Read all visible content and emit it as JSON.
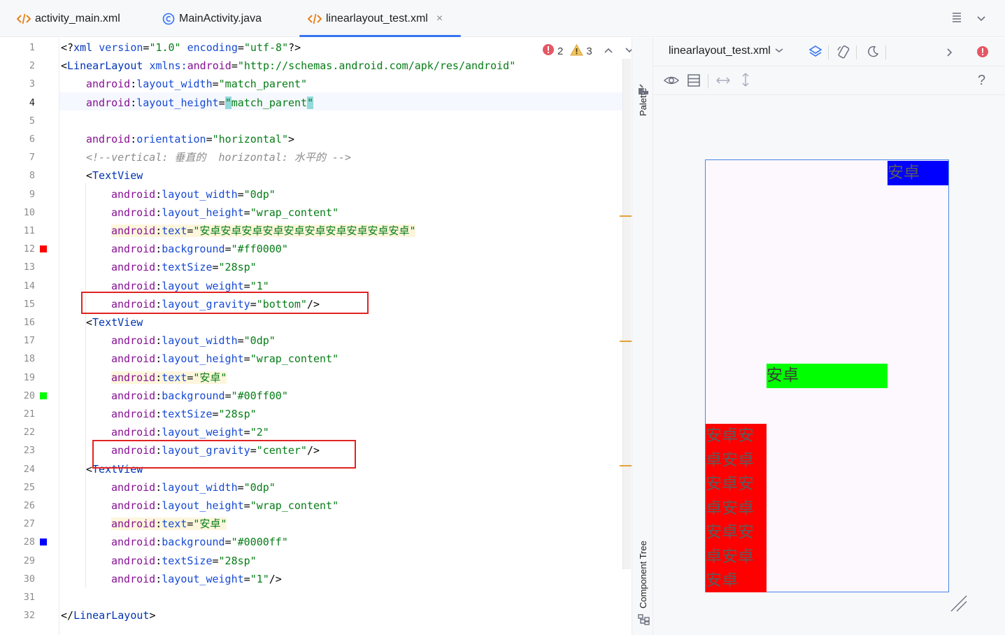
{
  "tabs": [
    {
      "label": "activity_main.xml",
      "icon": "xml-file-icon",
      "active": false
    },
    {
      "label": "MainActivity.java",
      "icon": "java-class-icon",
      "active": false
    },
    {
      "label": "linearlayout_test.xml",
      "icon": "xml-file-icon",
      "active": true,
      "close": "×"
    }
  ],
  "editor": {
    "inspection": {
      "errors": "2",
      "warnings": "3"
    },
    "current_line": 4,
    "lines": [
      {
        "n": "1",
        "tokens": [
          [
            "pl",
            "<?"
          ],
          [
            "tg",
            "xml "
          ],
          [
            "an",
            "version"
          ],
          [
            "pl",
            "="
          ],
          [
            "vl",
            "\"1.0\""
          ],
          [
            "pl",
            " "
          ],
          [
            "an",
            "encoding"
          ],
          [
            "pl",
            "="
          ],
          [
            "vl",
            "\"utf-8\""
          ],
          [
            "pl",
            "?>"
          ]
        ]
      },
      {
        "n": "2",
        "tokens": [
          [
            "pl",
            "<"
          ],
          [
            "tg",
            "LinearLayout "
          ],
          [
            "an",
            "xmlns:"
          ],
          [
            "ns",
            "android"
          ],
          [
            "pl",
            "="
          ],
          [
            "vl",
            "\"http://schemas.android.com/apk/res/android\""
          ]
        ]
      },
      {
        "n": "3",
        "indent": 1,
        "tokens": [
          [
            "ns",
            "android"
          ],
          [
            "pl",
            ":"
          ],
          [
            "an",
            "layout_width"
          ],
          [
            "pl",
            "="
          ],
          [
            "vl",
            "\"match_parent\""
          ]
        ]
      },
      {
        "n": "4",
        "indent": 1,
        "tokens": [
          [
            "ns",
            "android"
          ],
          [
            "pl",
            ":"
          ],
          [
            "an",
            "layout_height"
          ],
          [
            "pl",
            "="
          ],
          [
            "vlq",
            "\""
          ],
          [
            "vl",
            "match_parent"
          ],
          [
            "vlq",
            "\""
          ]
        ]
      },
      {
        "n": "5",
        "tokens": []
      },
      {
        "n": "6",
        "indent": 1,
        "tokens": [
          [
            "ns",
            "android"
          ],
          [
            "pl",
            ":"
          ],
          [
            "an",
            "orientation"
          ],
          [
            "pl",
            "="
          ],
          [
            "vl",
            "\"horizontal\""
          ],
          [
            "pl",
            ">"
          ]
        ]
      },
      {
        "n": "7",
        "indent": 1,
        "tokens": [
          [
            "cm",
            "<!--vertical: 垂直的  horizontal: 水平的 -->"
          ]
        ]
      },
      {
        "n": "8",
        "indent": 1,
        "tokens": [
          [
            "pl",
            "<"
          ],
          [
            "tg",
            "TextView"
          ]
        ]
      },
      {
        "n": "9",
        "indent": 2,
        "tokens": [
          [
            "ns",
            "android"
          ],
          [
            "pl",
            ":"
          ],
          [
            "an",
            "layout_width"
          ],
          [
            "pl",
            "="
          ],
          [
            "vl",
            "\"0dp\""
          ]
        ]
      },
      {
        "n": "10",
        "indent": 2,
        "tokens": [
          [
            "ns",
            "android"
          ],
          [
            "pl",
            ":"
          ],
          [
            "an",
            "layout_height"
          ],
          [
            "pl",
            "="
          ],
          [
            "vl",
            "\"wrap_content\""
          ]
        ]
      },
      {
        "n": "11",
        "indent": 2,
        "hl": true,
        "tokens": [
          [
            "ns",
            "android"
          ],
          [
            "pl",
            ":"
          ],
          [
            "an",
            "text"
          ],
          [
            "pl",
            "="
          ],
          [
            "vl",
            "\"安卓安卓安卓安卓安卓安卓安卓安卓安卓安卓\""
          ]
        ]
      },
      {
        "n": "12",
        "indent": 2,
        "mark": "#ff0000",
        "tokens": [
          [
            "ns",
            "android"
          ],
          [
            "pl",
            ":"
          ],
          [
            "an",
            "background"
          ],
          [
            "pl",
            "="
          ],
          [
            "vl",
            "\"#ff0000\""
          ]
        ]
      },
      {
        "n": "13",
        "indent": 2,
        "tokens": [
          [
            "ns",
            "android"
          ],
          [
            "pl",
            ":"
          ],
          [
            "an",
            "textSize"
          ],
          [
            "pl",
            "="
          ],
          [
            "vl",
            "\"28sp\""
          ]
        ]
      },
      {
        "n": "14",
        "indent": 2,
        "tokens": [
          [
            "ns",
            "android"
          ],
          [
            "pl",
            ":"
          ],
          [
            "an",
            "layout_weight"
          ],
          [
            "pl",
            "="
          ],
          [
            "vl",
            "\"1\""
          ]
        ]
      },
      {
        "n": "15",
        "indent": 2,
        "tokens": [
          [
            "ns",
            "android"
          ],
          [
            "pl",
            ":"
          ],
          [
            "an",
            "layout_gravity"
          ],
          [
            "pl",
            "="
          ],
          [
            "vl",
            "\"bottom\""
          ],
          [
            "pl",
            "/>"
          ]
        ]
      },
      {
        "n": "16",
        "indent": 1,
        "tokens": [
          [
            "pl",
            "<"
          ],
          [
            "tg",
            "TextView"
          ]
        ]
      },
      {
        "n": "17",
        "indent": 2,
        "tokens": [
          [
            "ns",
            "android"
          ],
          [
            "pl",
            ":"
          ],
          [
            "an",
            "layout_width"
          ],
          [
            "pl",
            "="
          ],
          [
            "vl",
            "\"0dp\""
          ]
        ]
      },
      {
        "n": "18",
        "indent": 2,
        "tokens": [
          [
            "ns",
            "android"
          ],
          [
            "pl",
            ":"
          ],
          [
            "an",
            "layout_height"
          ],
          [
            "pl",
            "="
          ],
          [
            "vl",
            "\"wrap_content\""
          ]
        ]
      },
      {
        "n": "19",
        "indent": 2,
        "hl": true,
        "tokens": [
          [
            "ns",
            "android"
          ],
          [
            "pl",
            ":"
          ],
          [
            "an",
            "text"
          ],
          [
            "pl",
            "="
          ],
          [
            "vl",
            "\"安卓\""
          ]
        ]
      },
      {
        "n": "20",
        "indent": 2,
        "mark": "#00ff00",
        "tokens": [
          [
            "ns",
            "android"
          ],
          [
            "pl",
            ":"
          ],
          [
            "an",
            "background"
          ],
          [
            "pl",
            "="
          ],
          [
            "vl",
            "\"#00ff00\""
          ]
        ]
      },
      {
        "n": "21",
        "indent": 2,
        "tokens": [
          [
            "ns",
            "android"
          ],
          [
            "pl",
            ":"
          ],
          [
            "an",
            "textSize"
          ],
          [
            "pl",
            "="
          ],
          [
            "vl",
            "\"28sp\""
          ]
        ]
      },
      {
        "n": "22",
        "indent": 2,
        "tokens": [
          [
            "ns",
            "android"
          ],
          [
            "pl",
            ":"
          ],
          [
            "an",
            "layout_weight"
          ],
          [
            "pl",
            "="
          ],
          [
            "vl",
            "\"2\""
          ]
        ]
      },
      {
        "n": "23",
        "indent": 2,
        "tokens": [
          [
            "ns",
            "android"
          ],
          [
            "pl",
            ":"
          ],
          [
            "an",
            "layout_gravity"
          ],
          [
            "pl",
            "="
          ],
          [
            "vl",
            "\"center\""
          ],
          [
            "pl",
            "/>"
          ]
        ]
      },
      {
        "n": "24",
        "indent": 1,
        "tokens": [
          [
            "pl",
            "<"
          ],
          [
            "tg",
            "TextView"
          ]
        ]
      },
      {
        "n": "25",
        "indent": 2,
        "tokens": [
          [
            "ns",
            "android"
          ],
          [
            "pl",
            ":"
          ],
          [
            "an",
            "layout_width"
          ],
          [
            "pl",
            "="
          ],
          [
            "vl",
            "\"0dp\""
          ]
        ]
      },
      {
        "n": "26",
        "indent": 2,
        "tokens": [
          [
            "ns",
            "android"
          ],
          [
            "pl",
            ":"
          ],
          [
            "an",
            "layout_height"
          ],
          [
            "pl",
            "="
          ],
          [
            "vl",
            "\"wrap_content\""
          ]
        ]
      },
      {
        "n": "27",
        "indent": 2,
        "hl": true,
        "tokens": [
          [
            "ns",
            "android"
          ],
          [
            "pl",
            ":"
          ],
          [
            "an",
            "text"
          ],
          [
            "pl",
            "="
          ],
          [
            "vl",
            "\"安卓\""
          ]
        ]
      },
      {
        "n": "28",
        "indent": 2,
        "mark": "#0000ff",
        "tokens": [
          [
            "ns",
            "android"
          ],
          [
            "pl",
            ":"
          ],
          [
            "an",
            "background"
          ],
          [
            "pl",
            "="
          ],
          [
            "vl",
            "\"#0000ff\""
          ]
        ]
      },
      {
        "n": "29",
        "indent": 2,
        "tokens": [
          [
            "ns",
            "android"
          ],
          [
            "pl",
            ":"
          ],
          [
            "an",
            "textSize"
          ],
          [
            "pl",
            "="
          ],
          [
            "vl",
            "\"28sp\""
          ]
        ]
      },
      {
        "n": "30",
        "indent": 2,
        "tokens": [
          [
            "ns",
            "android"
          ],
          [
            "pl",
            ":"
          ],
          [
            "an",
            "layout_weight"
          ],
          [
            "pl",
            "="
          ],
          [
            "vl",
            "\"1\""
          ],
          [
            "pl",
            "/>"
          ]
        ]
      },
      {
        "n": "31",
        "tokens": []
      },
      {
        "n": "32",
        "tokens": [
          [
            "pl",
            "</"
          ],
          [
            "tg",
            "LinearLayout"
          ],
          [
            "pl",
            ">"
          ]
        ]
      }
    ]
  },
  "side_strip": {
    "palette": "Palette",
    "component_tree": "Component Tree"
  },
  "design": {
    "file": "linearlayout_test.xml",
    "help": "?",
    "preview": {
      "red": {
        "text": "安卓安卓安卓安卓安卓安卓安卓安卓安卓安卓",
        "bg": "#ff0000"
      },
      "green": {
        "text": "安卓",
        "bg": "#00ff00"
      },
      "blue": {
        "text": "安卓",
        "bg": "#0000ff"
      }
    }
  },
  "colors": {
    "accent": "#3574f0",
    "annotation_box": "#e32222",
    "warning_tick": "#e2a33a"
  }
}
